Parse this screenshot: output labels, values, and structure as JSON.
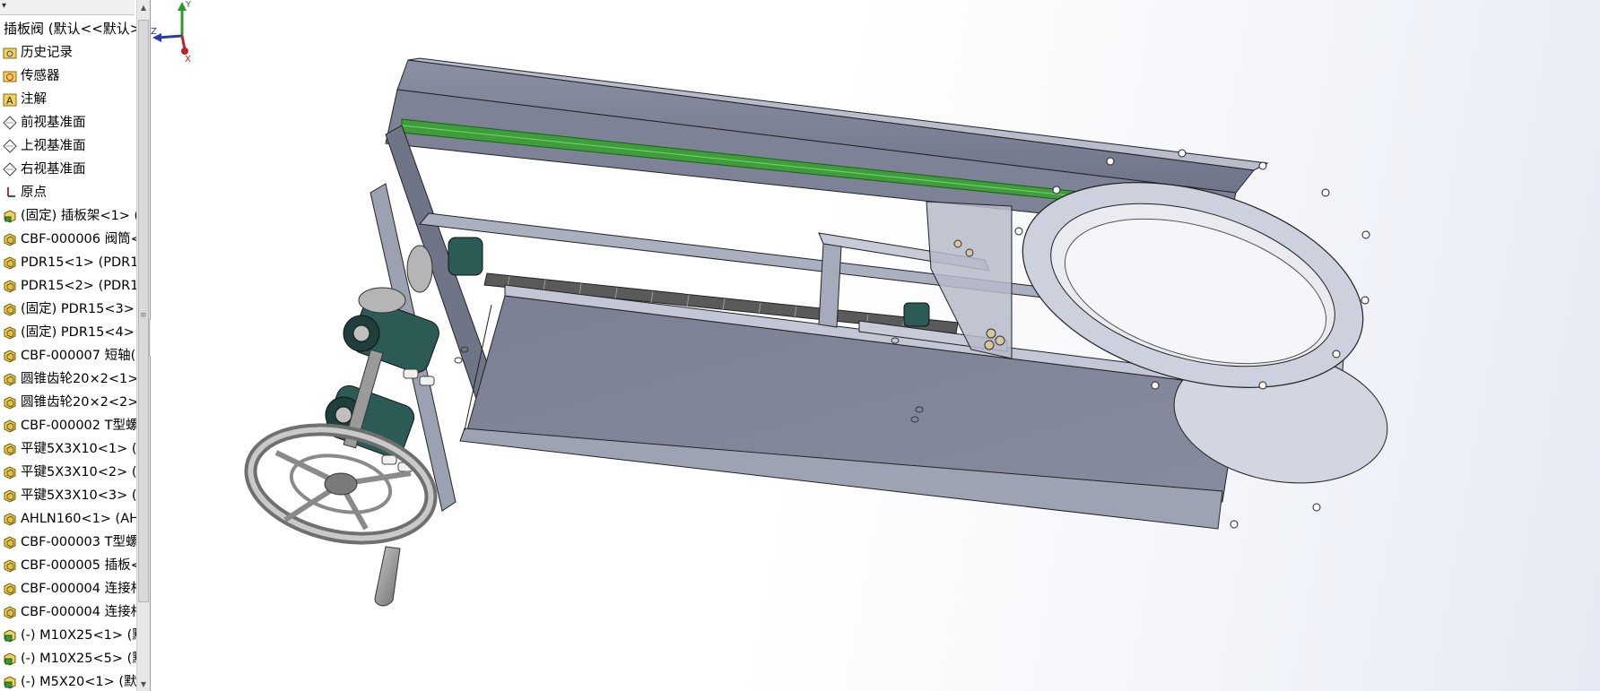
{
  "tree": {
    "root_label": "插板阀 (默认<<默认>",
    "items": [
      {
        "label": "历史记录",
        "icon": "history-icon"
      },
      {
        "label": "传感器",
        "icon": "sensor-icon"
      },
      {
        "label": "注解",
        "icon": "annotation-icon"
      },
      {
        "label": "前视基准面",
        "icon": "plane-icon"
      },
      {
        "label": "上视基准面",
        "icon": "plane-icon"
      },
      {
        "label": "右视基准面",
        "icon": "plane-icon"
      },
      {
        "label": "原点",
        "icon": "origin-icon"
      },
      {
        "label": "(固定) 插板架<1> (",
        "icon": "assembly-component-icon"
      },
      {
        "label": "CBF-000006 阀筒<",
        "icon": "part-component-icon"
      },
      {
        "label": "PDR15<1> (PDR1",
        "icon": "part-component-icon"
      },
      {
        "label": "PDR15<2> (PDR1",
        "icon": "part-component-icon"
      },
      {
        "label": "(固定) PDR15<3>",
        "icon": "part-component-icon"
      },
      {
        "label": "(固定) PDR15<4>",
        "icon": "part-component-icon"
      },
      {
        "label": "CBF-000007 短轴(",
        "icon": "part-component-icon"
      },
      {
        "label": "圆锥齿轮20×2<1>",
        "icon": "part-component-icon"
      },
      {
        "label": "圆锥齿轮20×2<2>",
        "icon": "part-component-icon"
      },
      {
        "label": "CBF-000002 T型螺",
        "icon": "part-component-icon"
      },
      {
        "label": "平键5X3X10<1> (",
        "icon": "part-component-icon"
      },
      {
        "label": "平键5X3X10<2> (",
        "icon": "part-component-icon"
      },
      {
        "label": "平键5X3X10<3> (",
        "icon": "part-component-icon"
      },
      {
        "label": "AHLN160<1> (AH",
        "icon": "part-component-icon"
      },
      {
        "label": "CBF-000003 T型螺",
        "icon": "part-component-icon"
      },
      {
        "label": "CBF-000005 插板<",
        "icon": "part-component-icon"
      },
      {
        "label": "CBF-000004 连接杆",
        "icon": "part-component-icon"
      },
      {
        "label": "CBF-000004 连接杆",
        "icon": "part-component-icon"
      },
      {
        "label": "(-) M10X25<1> (默",
        "icon": "toolbox-part-icon"
      },
      {
        "label": "(-) M10X25<5> (默",
        "icon": "toolbox-part-icon"
      },
      {
        "label": "(-) M5X20<1> (默",
        "icon": "toolbox-part-icon"
      }
    ]
  },
  "triad": {
    "x": "X",
    "y": "Y",
    "z": "Z"
  },
  "colors": {
    "body_metal": "#7e8396",
    "body_light": "#b9bdcc",
    "flange": "#c4c8d6",
    "bearing_green": "#2c5a55",
    "rail_green": "#3e9e3a",
    "handwheel": "#9a9a9a"
  }
}
